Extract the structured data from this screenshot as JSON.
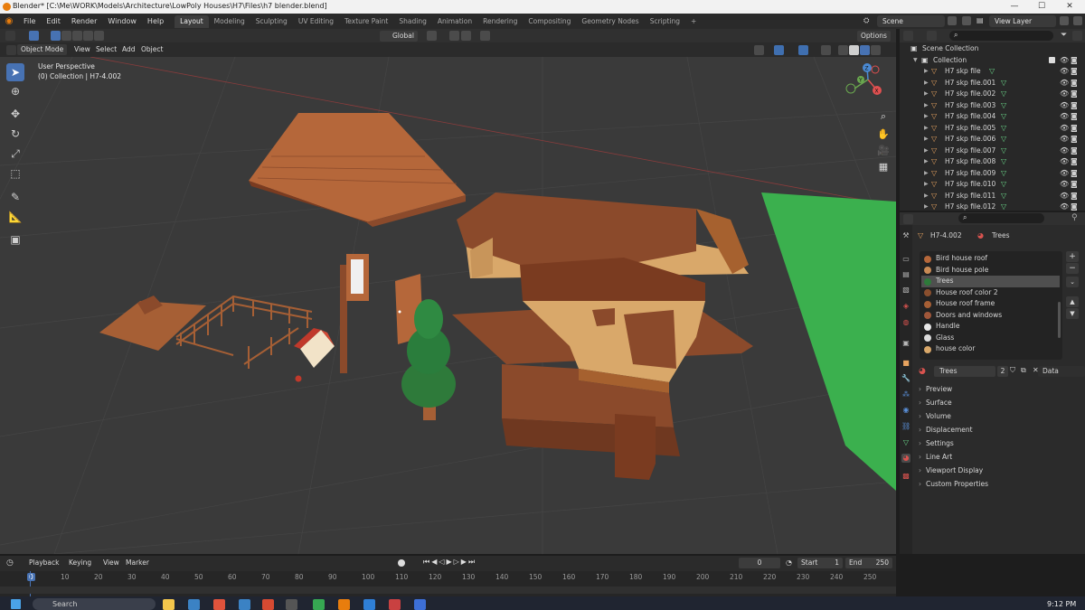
{
  "title_bar": {
    "title": "Blender* [C:\\Me\\WORK\\Models\\Architecture\\LowPoly Houses\\H7\\Files\\h7 blender.blend]",
    "minimize": "—",
    "maximize": "☐",
    "close": "✕"
  },
  "menu": [
    "File",
    "Edit",
    "Render",
    "Window",
    "Help"
  ],
  "workspaces": [
    "Layout",
    "Modeling",
    "Sculpting",
    "UV Editing",
    "Texture Paint",
    "Shading",
    "Animation",
    "Rendering",
    "Compositing",
    "Geometry Nodes",
    "Scripting"
  ],
  "add_workspace": "+",
  "scene": {
    "value": "Scene"
  },
  "view_layer": {
    "value": "View Layer"
  },
  "tool_header": {
    "transform_orientation": "Global",
    "options": "Options"
  },
  "view_header": {
    "mode": "Object Mode",
    "menus": [
      "View",
      "Select",
      "Add",
      "Object"
    ]
  },
  "viewport": {
    "perspective": "User Perspective",
    "collection_info": "(0) Collection | H7-4.002",
    "gizmo_axes": [
      "X",
      "Y",
      "Z"
    ]
  },
  "timeline": {
    "menus": [
      "Playback",
      "Keying",
      "View",
      "Marker"
    ],
    "current_frame": "0",
    "start_label": "Start",
    "start": "1",
    "end_label": "End",
    "end": "250",
    "ticks": [
      "0",
      "10",
      "20",
      "30",
      "40",
      "50",
      "60",
      "70",
      "80",
      "90",
      "100",
      "110",
      "120",
      "130",
      "140",
      "150",
      "160",
      "170",
      "180",
      "190",
      "200",
      "210",
      "220",
      "230",
      "240",
      "250"
    ]
  },
  "outliner": {
    "root": "Scene Collection",
    "collection": "Collection",
    "items": [
      "H7 skp file",
      "H7 skp file.001",
      "H7 skp file.002",
      "H7 skp file.003",
      "H7 skp file.004",
      "H7 skp file.005",
      "H7 skp file.006",
      "H7 skp file.007",
      "H7 skp file.008",
      "H7 skp file.009",
      "H7 skp file.010",
      "H7 skp file.011",
      "H7 skp file.012"
    ]
  },
  "properties": {
    "object_name": "H7-4.002",
    "material_name": "Trees",
    "slots": [
      {
        "name": "Bird house roof",
        "color": "#b5673a"
      },
      {
        "name": "Bird house pole",
        "color": "#c88a55"
      },
      {
        "name": "Trees",
        "color": "#2e7a3a"
      },
      {
        "name": "House roof color 2",
        "color": "#8a4f2e"
      },
      {
        "name": "House roof frame",
        "color": "#a65f35"
      },
      {
        "name": "Doors and windows",
        "color": "#a0573a"
      },
      {
        "name": "Handle",
        "color": "#e6e6e6"
      },
      {
        "name": "Glass",
        "color": "#dcdcdc"
      },
      {
        "name": "house color",
        "color": "#d9a86a"
      }
    ],
    "material_field": "Trees",
    "users": "2",
    "link": "Data",
    "panels": [
      "Preview",
      "Surface",
      "Volume",
      "Displacement",
      "Settings",
      "Line Art",
      "Viewport Display",
      "Custom Properties"
    ]
  },
  "taskbar": {
    "search": "Search",
    "time": "9:12 PM"
  },
  "colors": {
    "accent": "#4772b3",
    "roof": "#8b4a2b",
    "wall": "#d9a86a",
    "tree": "#2e7a3a",
    "plane": "#3bb04e"
  }
}
